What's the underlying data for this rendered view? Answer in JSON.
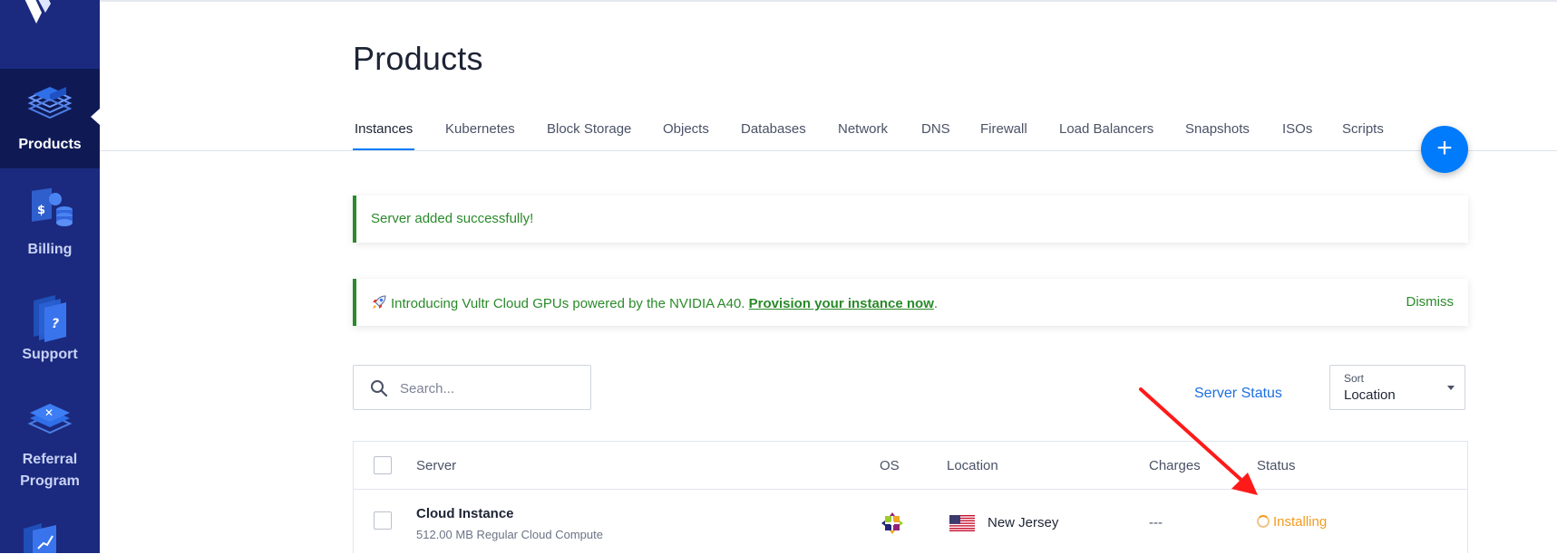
{
  "sidebar": {
    "items": [
      {
        "label": "Products",
        "icon": "products-layers-icon",
        "active": true
      },
      {
        "label": "Billing",
        "icon": "billing-icon"
      },
      {
        "label": "Support",
        "icon": "support-icon"
      },
      {
        "label": "Referral Program",
        "label_lines": [
          "Referral",
          "Program"
        ],
        "icon": "referral-icon"
      }
    ],
    "colors": {
      "background": "#1b2a7e",
      "active_background": "#0f1a55"
    }
  },
  "page": {
    "title": "Products"
  },
  "tabs": [
    {
      "label": "Instances",
      "active": true
    },
    {
      "label": "Kubernetes"
    },
    {
      "label": "Block Storage"
    },
    {
      "label": "Objects"
    },
    {
      "label": "Databases"
    },
    {
      "label": "Network"
    },
    {
      "label": "DNS"
    },
    {
      "label": "Firewall"
    },
    {
      "label": "Load Balancers"
    },
    {
      "label": "Snapshots"
    },
    {
      "label": "ISOs"
    },
    {
      "label": "Scripts"
    }
  ],
  "fab": {
    "label": "+",
    "icon": "plus-icon"
  },
  "alerts": {
    "success": {
      "text": "Server added successfully!"
    },
    "promo": {
      "icon": "rocket-icon",
      "text": "Introducing Vultr Cloud GPUs powered by the NVIDIA A40. ",
      "link": "Provision your instance now",
      "suffix": ".",
      "dismiss": "Dismiss"
    }
  },
  "search": {
    "placeholder": "Search...",
    "value": ""
  },
  "server_status_link": "Server Status",
  "sort": {
    "label": "Sort",
    "value": "Location"
  },
  "table": {
    "columns": {
      "server": "Server",
      "os": "OS",
      "location": "Location",
      "charges": "Charges",
      "status": "Status"
    },
    "rows": [
      {
        "name": "Cloud Instance",
        "plan": "512.00 MB Regular Cloud Compute",
        "os_icon": "centos-icon",
        "flag_icon": "us-flag-icon",
        "location": "New Jersey",
        "charges": "---",
        "status": "Installing"
      }
    ]
  },
  "colors": {
    "accent": "#007bfc",
    "success": "#2a8a2a",
    "status_installing": "#f39b1f",
    "annotation_arrow": "#ff1a1a"
  }
}
